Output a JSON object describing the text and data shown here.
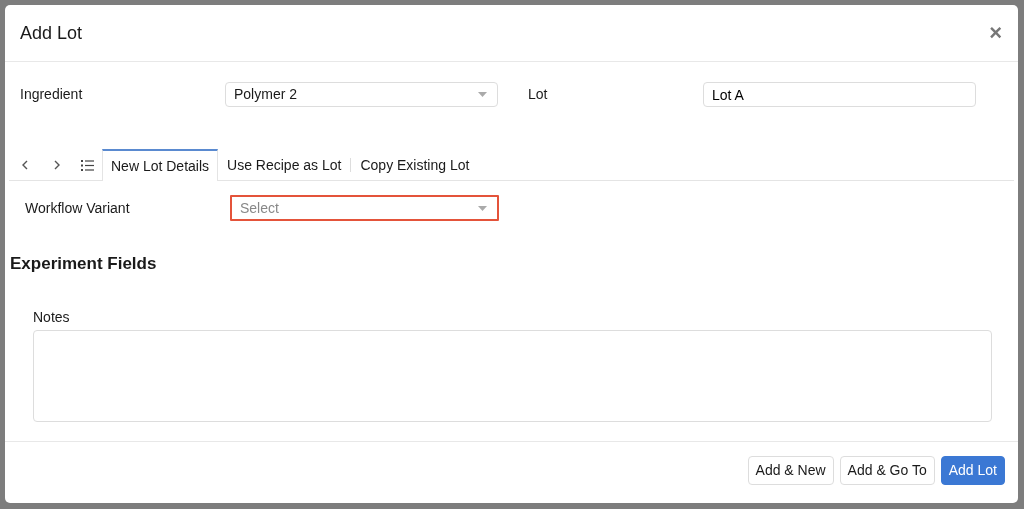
{
  "dialog": {
    "title": "Add Lot",
    "close": "×"
  },
  "fields": [
    {
      "label": "Ingredient",
      "kind": "select",
      "value": "Polymer 2"
    },
    {
      "label": "Lot",
      "kind": "text",
      "value": "Lot A"
    }
  ],
  "tabs": [
    {
      "label": "New Lot Details",
      "selected": true
    },
    {
      "label": "Use Recipe as Lot",
      "selected": false
    },
    {
      "label": "Copy Existing Lot",
      "selected": false
    }
  ],
  "workflow_variant": {
    "label": "Workflow Variant",
    "placeholder": "Select",
    "highlighted": true
  },
  "section": {
    "title": "Experiment Fields"
  },
  "notes": {
    "label": "Notes"
  },
  "buttons": [
    {
      "label": "Add & New",
      "primary": false
    },
    {
      "label": "Add & Go To",
      "primary": false
    },
    {
      "label": "Add Lot",
      "primary": true
    }
  ]
}
